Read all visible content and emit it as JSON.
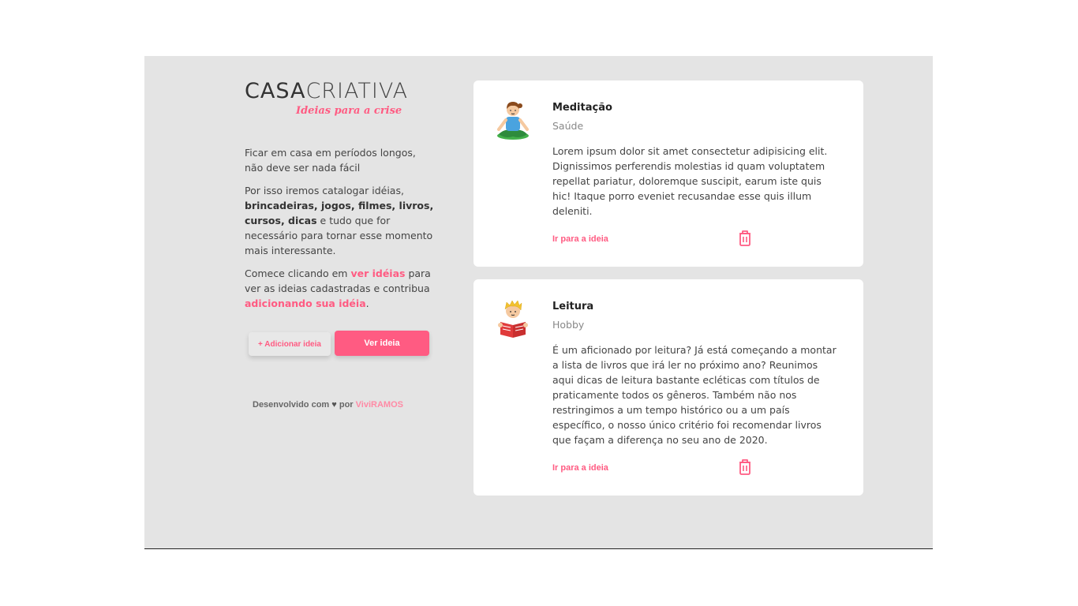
{
  "logo": {
    "part_bold": "CASA",
    "part_light": "CRIATIVA",
    "tagline": "Ideias para a crise"
  },
  "intro": {
    "p1": "Ficar em casa em períodos longos, não deve ser nada fácil",
    "p2_start": "Por isso iremos catalogar idéias, ",
    "p2_bold": "brincadeiras, jogos, filmes, livros, cursos, dicas",
    "p2_end": " e tudo que for necessário para tornar esse momento mais interessante.",
    "p3_start": "Comece clicando em ",
    "p3_link1": "ver idéias",
    "p3_mid": " para ver as ideias cadastradas e contribua ",
    "p3_link2": "adicionando sua idéia",
    "p3_end": "."
  },
  "buttons": {
    "add_label": "+ Adicionar ideia",
    "view_label": "Ver ideia"
  },
  "credit": {
    "prefix": "Desenvolvido com",
    "heart": "♥",
    "middle": "por",
    "author": "ViviRAMOS"
  },
  "ideas": [
    {
      "icon": "meditation-person-icon",
      "title": "Meditação",
      "category": "Saúde",
      "description": "Lorem ipsum dolor sit amet consectetur adipisicing elit. Dignissimos perferendis molestias id quam voluptatem repellat pariatur, doloremque suscipit, earum iste quis hic! Itaque porro eveniet recusandae esse quis illum deleniti.",
      "link": "Ir para a ideia"
    },
    {
      "icon": "reading-person-icon",
      "title": "Leitura",
      "category": "Hobby",
      "description": "É um aficionado por leitura? Já está começando a montar a lista de livros que irá ler no próximo ano? Reunimos aqui dicas de leitura bastante ecléticas com títulos de praticamente todos os gêneros. Também não nos restringimos a um tempo histórico ou a um país específico, o nosso único critério foi recomendar livros que façam a diferença no seu ano de 2020.",
      "link": "Ir para a ideia"
    }
  ],
  "colors": {
    "accent": "#ff5b82",
    "panel": "#e4e4e4",
    "card": "#ffffff"
  }
}
